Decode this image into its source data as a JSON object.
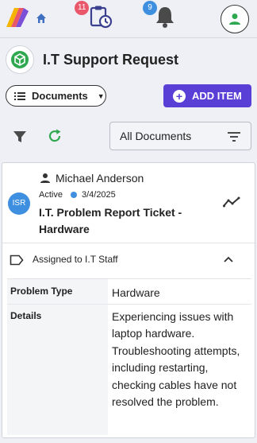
{
  "topbar": {
    "logo_icon": "app-logo-icon",
    "home_icon": "home-icon",
    "tasks_badge": "11",
    "notifications_badge": "9",
    "profile_icon": "person-icon"
  },
  "header": {
    "title": "I.T Support Request",
    "documents_label": "Documents",
    "add_item_label": "ADD ITEM",
    "filter_select_value": "All Documents"
  },
  "card": {
    "owner_name": "Michael Anderson",
    "avatar_initials": "ISR",
    "status": "Active",
    "date": "3/4/2025",
    "title": "I.T. Problem Report Ticket - Hardware",
    "assigned_label": "Assigned to I.T Staff",
    "details": [
      {
        "key": "Problem Type",
        "value": "Hardware"
      },
      {
        "key": "Details",
        "value": "Experiencing issues with laptop hardware. Troubleshooting attempts, including restarting, checking cables have not resolved the problem."
      }
    ]
  },
  "colors": {
    "accent_purple": "#5a3fd6",
    "blue": "#3f8fe0",
    "green": "#2fa84f",
    "badge_red": "#e8586a"
  }
}
